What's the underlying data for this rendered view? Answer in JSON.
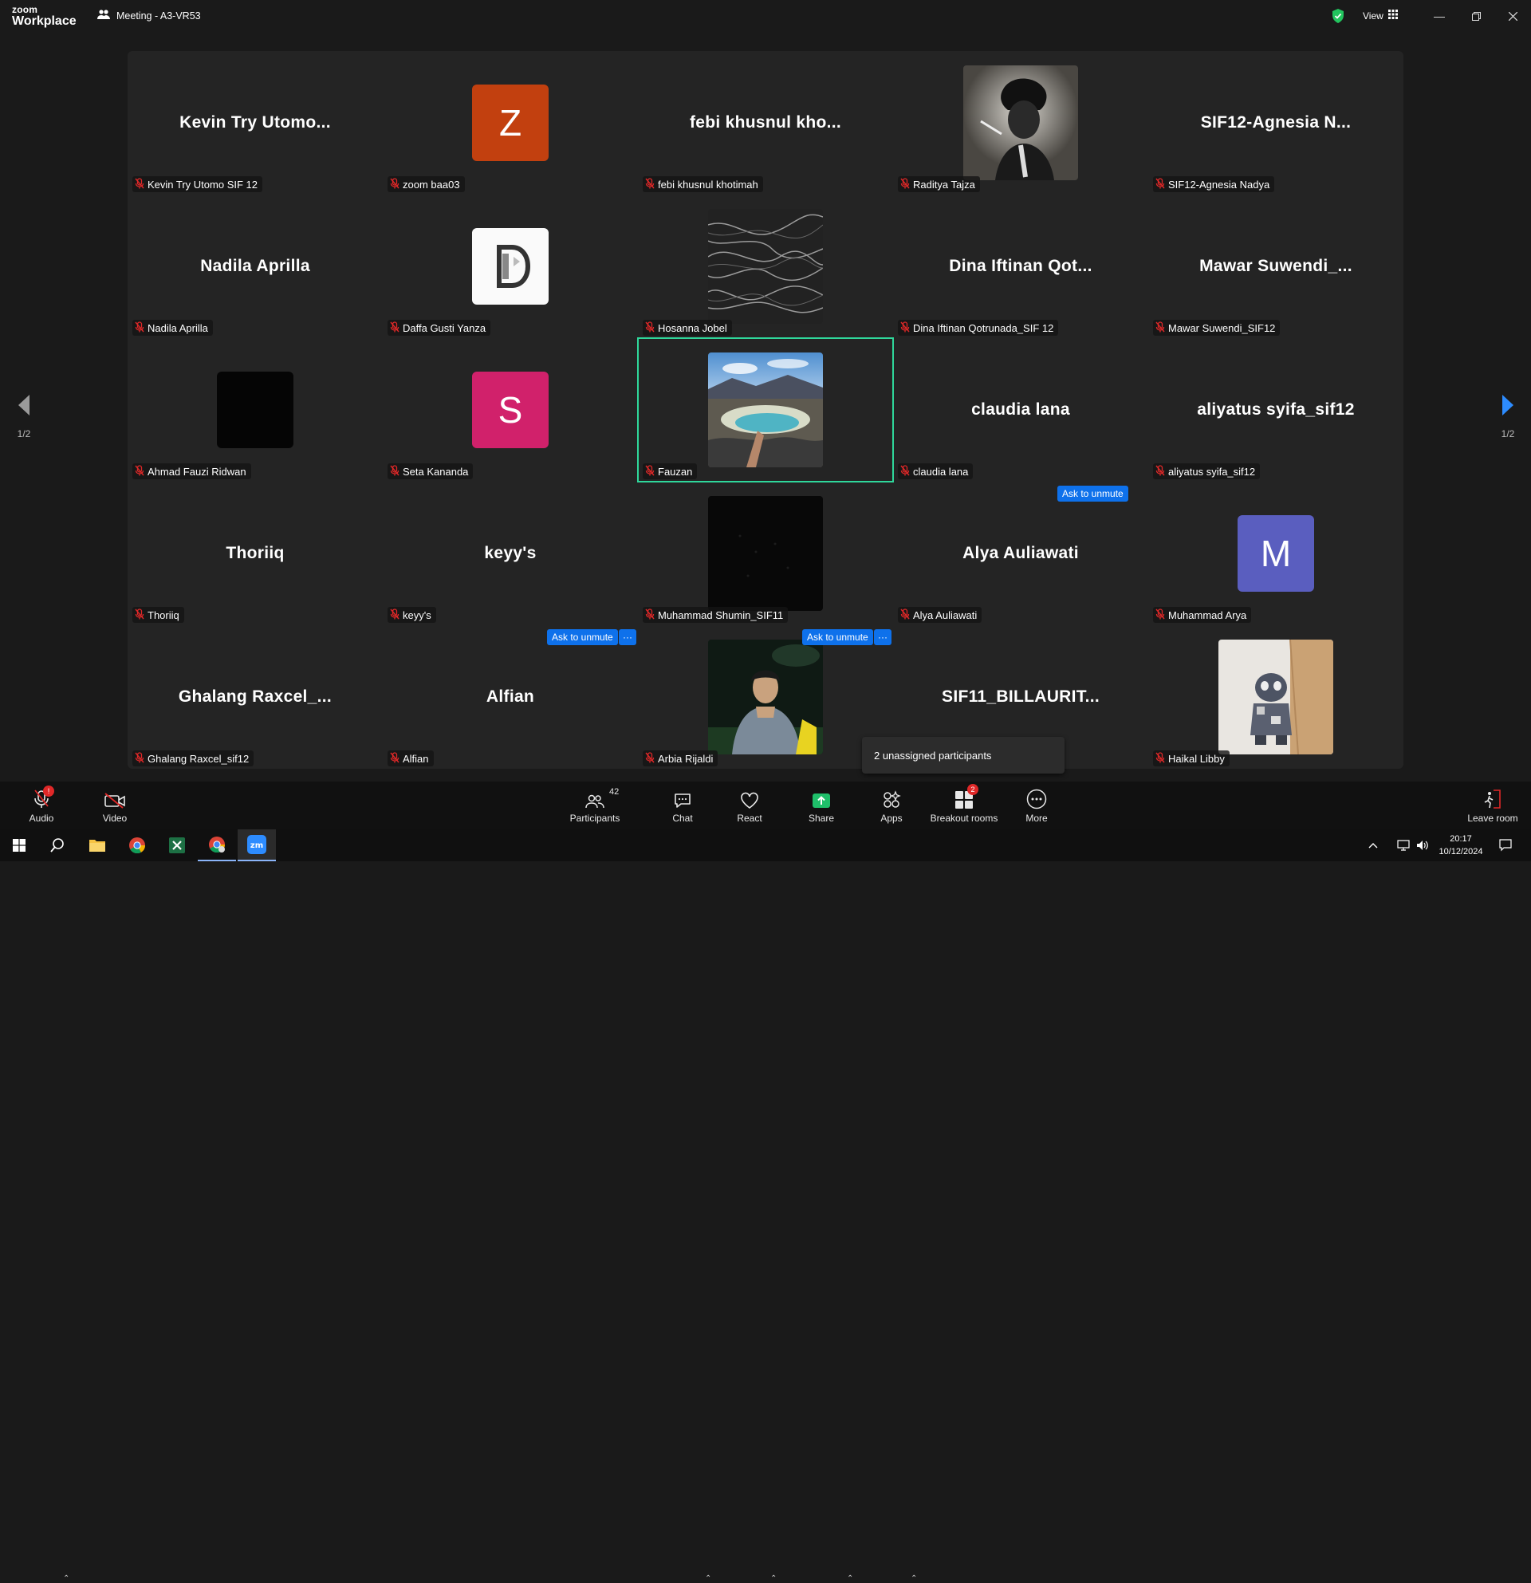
{
  "titlebar": {
    "logo_line1": "zoom",
    "logo_line2": "Workplace",
    "meeting_title": "Meeting - A3-VR53",
    "view_label": "View"
  },
  "participants": [
    {
      "display": "Kevin  Try  Utomo...",
      "label": "Kevin Try Utomo SIF 12",
      "type": "name"
    },
    {
      "display": "Z",
      "label": "zoom baa03",
      "type": "letter",
      "color": "#c2400f"
    },
    {
      "display": "febi  khusnul  kho...",
      "label": "febi khusnul khotimah",
      "type": "name"
    },
    {
      "display": "",
      "label": "Raditya Tajza",
      "type": "image",
      "img": "portrait-photo"
    },
    {
      "display": "SIF12-Agnesia  N...",
      "label": "SIF12-Agnesia Nadya",
      "type": "name"
    },
    {
      "display": "Nadila Aprilla",
      "label": "Nadila Aprilla",
      "type": "name"
    },
    {
      "display": "",
      "label": "Daffa Gusti Yanza",
      "type": "image",
      "img": "logo-white"
    },
    {
      "display": "",
      "label": "Hosanna Jobel",
      "type": "image",
      "img": "marble-pattern"
    },
    {
      "display": "Dina  Iftinan  Qot...",
      "label": "Dina Iftinan Qotrunada_SIF 12",
      "type": "name"
    },
    {
      "display": "Mawar  Suwendi_...",
      "label": "Mawar Suwendi_SIF12",
      "type": "name"
    },
    {
      "display": "",
      "label": "Ahmad Fauzi Ridwan",
      "type": "image",
      "img": "black-square"
    },
    {
      "display": "S",
      "label": "Seta Kananda",
      "type": "letter",
      "color": "#d1216b"
    },
    {
      "display": "",
      "label": "Fauzan",
      "type": "image",
      "img": "crater-lake"
    },
    {
      "display": "claudia lana",
      "label": "claudia lana",
      "type": "name"
    },
    {
      "display": "aliyatus syifa_sif12",
      "label": "aliyatus syifa_sif12",
      "type": "name"
    },
    {
      "display": "Thoriiq",
      "label": "Thoriiq",
      "type": "name"
    },
    {
      "display": "keyy's",
      "label": "keyy's",
      "type": "name"
    },
    {
      "display": "",
      "label": "Muhammad Shumin_SIF11",
      "type": "image",
      "img": "dark-photo"
    },
    {
      "display": "Alya Auliawati",
      "label": "Alya Auliawati",
      "type": "name"
    },
    {
      "display": "M",
      "label": "Muhammad Arya",
      "type": "letter",
      "color": "#5a5ebf"
    },
    {
      "display": "Ghalang  Raxcel_...",
      "label": "Ghalang Raxcel_sif12",
      "type": "name"
    },
    {
      "display": "Alfian",
      "label": "Alfian",
      "type": "name"
    },
    {
      "display": "",
      "label": "Arbia Rijaldi",
      "type": "image",
      "img": "soccer-player"
    },
    {
      "display": "SIF11_BILLAURIT...",
      "label": "",
      "type": "name"
    },
    {
      "display": "",
      "label": "Haikal Libby",
      "type": "image",
      "img": "toy-figure"
    }
  ],
  "ask_to_unmute": "Ask to unmute",
  "more_dots": "···",
  "page_indicator_left": "1/2",
  "page_indicator_right": "1/2",
  "unassigned_popup": "2 unassigned participants",
  "toolbar": {
    "audio": "Audio",
    "video": "Video",
    "participants": "Participants",
    "participants_count": "42",
    "chat": "Chat",
    "react": "React",
    "share": "Share",
    "apps": "Apps",
    "breakout": "Breakout rooms",
    "breakout_badge": "2",
    "more": "More",
    "leave": "Leave room"
  },
  "taskbar": {
    "time": "20:17",
    "date": "10/12/2024"
  },
  "colors": {
    "accent_blue": "#0e71eb",
    "active_speaker": "#2fd79b",
    "mute_red": "#e02828",
    "share_green": "#1fbf6a"
  }
}
